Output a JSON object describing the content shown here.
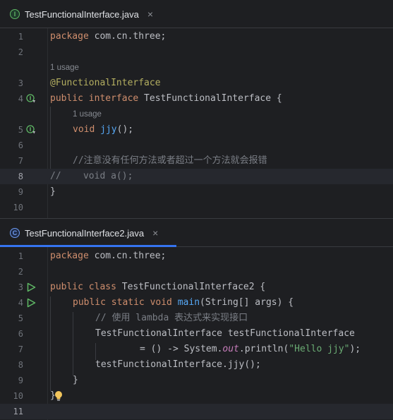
{
  "editor1": {
    "tab": {
      "filename": "TestFunctionalInterface.java",
      "icon_letter": "I",
      "icon": "interface-icon",
      "close": "×"
    },
    "lines": [
      {
        "num": "1"
      },
      {
        "num": "2"
      },
      {
        "num": "3"
      },
      {
        "num": "4"
      },
      {
        "num": "5"
      },
      {
        "num": "6"
      },
      {
        "num": "7"
      },
      {
        "num": "8"
      },
      {
        "num": "9"
      },
      {
        "num": "10"
      }
    ],
    "usage_hints": [
      "1 usage",
      "1 usage"
    ],
    "code": {
      "l1_kw": "package",
      "l1_rest": " com.cn.three;",
      "l3_ann": "@FunctionalInterface",
      "l4_kw": "public interface",
      "l4_rest": " TestFunctionalInterface {",
      "l5_kw": "void",
      "l5_fn": "jjy",
      "l5_rest": "();",
      "l7_comment": "//注意没有任何方法或者超过一个方法就会报错",
      "l8_comment": "//    void a();",
      "l9_rest": "}"
    }
  },
  "editor2": {
    "tab": {
      "filename": "TestFunctionalInterface2.java",
      "icon_letter": "C",
      "icon": "class-icon",
      "close": "×"
    },
    "lines": [
      {
        "num": "1"
      },
      {
        "num": "2"
      },
      {
        "num": "3"
      },
      {
        "num": "4"
      },
      {
        "num": "5"
      },
      {
        "num": "6"
      },
      {
        "num": "7"
      },
      {
        "num": "8"
      },
      {
        "num": "9"
      },
      {
        "num": "10"
      },
      {
        "num": "11"
      }
    ],
    "code": {
      "l1_kw": "package",
      "l1_rest": " com.cn.three;",
      "l3_kw": "public class",
      "l3_rest": " TestFunctionalInterface2 {",
      "l4_kw": "public static void",
      "l4_fn": "main",
      "l4_rest": "(String[] args) {",
      "l5_comment": "// 使用 lambda 表达式来实现接口",
      "l6_rest": "TestFunctionalInterface testFunctionalInterface",
      "l7_a": "= () -> System.",
      "l7_field": "out",
      "l7_b": ".println(",
      "l7_str": "\"Hello jjy\"",
      "l7_c": ");",
      "l8_rest": "testFunctionalInterface.jjy();",
      "l9_rest": "}",
      "l10_rest": "}"
    }
  }
}
